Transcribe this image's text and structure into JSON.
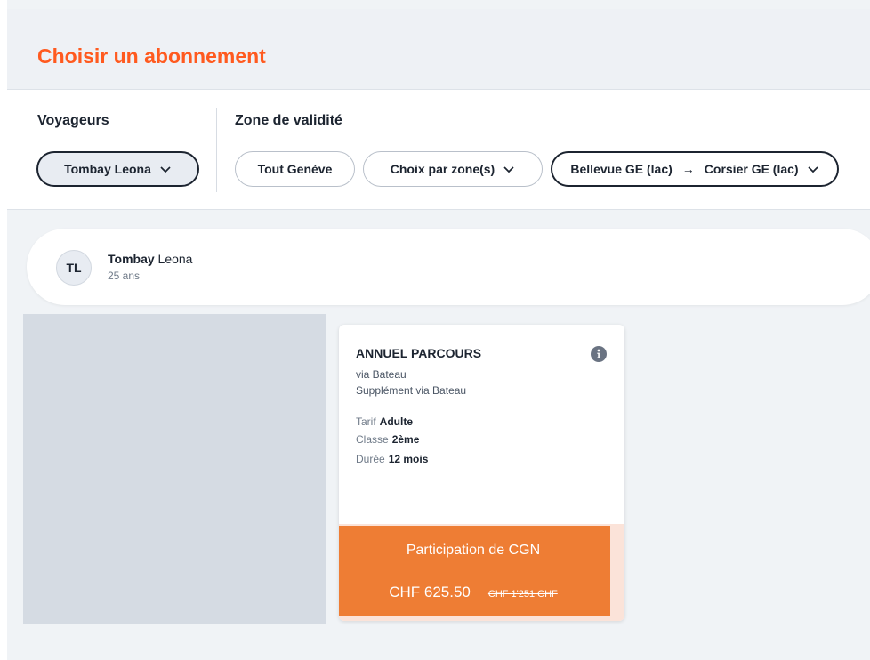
{
  "header": {
    "title": "Choisir un abonnement"
  },
  "filters": {
    "travelers_label": "Voyageurs",
    "traveler_chip": "Tombay Leona",
    "zone_label": "Zone de validité",
    "zone_chips": {
      "tout_geneve": "Tout Genève",
      "par_zone": "Choix par zone(s)",
      "route_from": "Bellevue GE (lac)",
      "route_arrow": "→",
      "route_to": "Corsier GE (lac)"
    }
  },
  "traveler": {
    "initials": "TL",
    "last_name": "Tombay",
    "first_name": "Leona",
    "age": "25 ans"
  },
  "offer": {
    "title": "ANNUEL PARCOURS",
    "via": "via Bateau",
    "supplement": "Supplément via Bateau",
    "tarif_label": "Tarif",
    "tarif_value": "Adulte",
    "classe_label": "Classe",
    "classe_value": "2ème",
    "duree_label": "Durée",
    "duree_value": "12 mois",
    "participation": "Participation de CGN",
    "price": "CHF 625.50",
    "old_price": "CHF 1'251 CHF"
  },
  "icons": {
    "info": "info-icon",
    "dropdown": "chevron-down-icon"
  },
  "colors": {
    "brand": "#ff5a1f",
    "price_bg": "#ee7d34",
    "text": "#1c2430"
  }
}
